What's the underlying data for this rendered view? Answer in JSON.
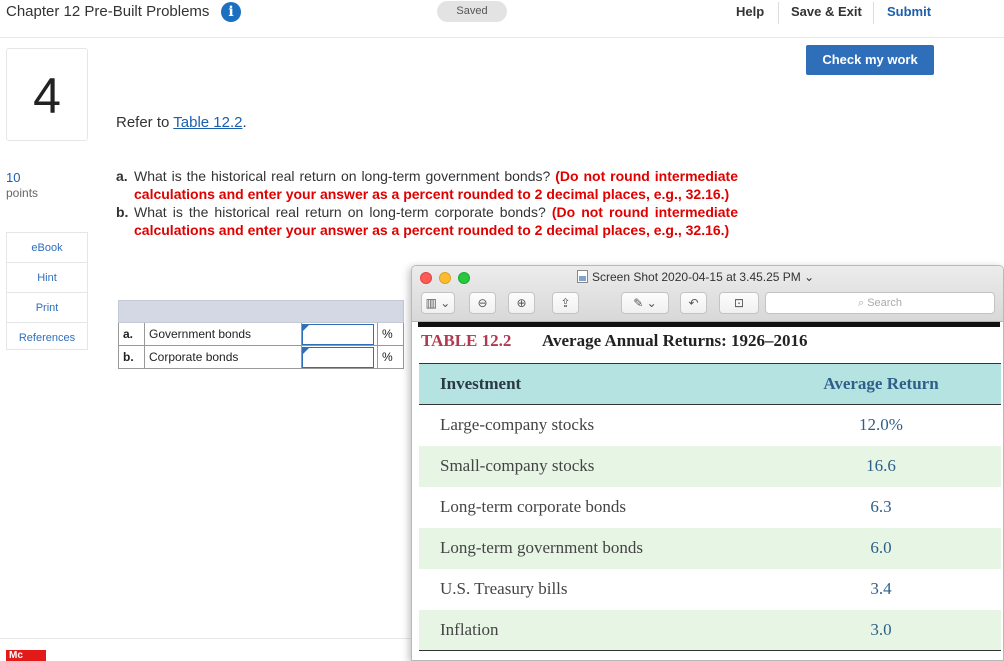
{
  "header": {
    "title": "Chapter 12 Pre-Built Problems",
    "saved_label": "Saved",
    "help_label": "Help",
    "save_exit_label": "Save & Exit",
    "submit_label": "Submit",
    "check_work_label": "Check my work"
  },
  "question": {
    "number": "4",
    "points_value": "10",
    "points_label": "points",
    "refer_prefix": "Refer to ",
    "refer_link": "Table 12.2",
    "refer_suffix": ".",
    "part_a_letter": "a.",
    "part_a_text": "What is the historical real return on long-term government bonds?",
    "part_a_note": "(Do not round intermediate calculations and enter your answer as a percent rounded to 2 decimal places, e.g., 32.16.)",
    "part_b_letter": "b.",
    "part_b_text": "What is the historical real return on long-term corporate bonds?",
    "part_b_note": "(Do not round intermediate calculations and enter your answer as a percent rounded to 2 decimal places, e.g., 32.16.)"
  },
  "tools": [
    "eBook",
    "Hint",
    "Print",
    "References"
  ],
  "answer_table": {
    "rows": [
      {
        "letter": "a.",
        "label": "Government bonds",
        "value": "",
        "unit": "%"
      },
      {
        "letter": "b.",
        "label": "Corporate bonds",
        "value": "",
        "unit": "%"
      }
    ]
  },
  "preview": {
    "window_title": "Screen Shot 2020-04-15 at 3.45.25 PM",
    "search_placeholder": "Search",
    "table_label": "TABLE 12.2",
    "table_caption": "Average Annual Returns: 1926–2016",
    "col_investment": "Investment",
    "col_return": "Average Return",
    "rows": [
      {
        "investment": "Large-company stocks",
        "return": "12.0%"
      },
      {
        "investment": "Small-company stocks",
        "return": "16.6"
      },
      {
        "investment": "Long-term corporate bonds",
        "return": "6.3"
      },
      {
        "investment": "Long-term government bonds",
        "return": "6.0"
      },
      {
        "investment": "U.S. Treasury bills",
        "return": "3.4"
      },
      {
        "investment": "Inflation",
        "return": "3.0"
      }
    ]
  },
  "footer": {
    "logo_text": "Mc"
  }
}
